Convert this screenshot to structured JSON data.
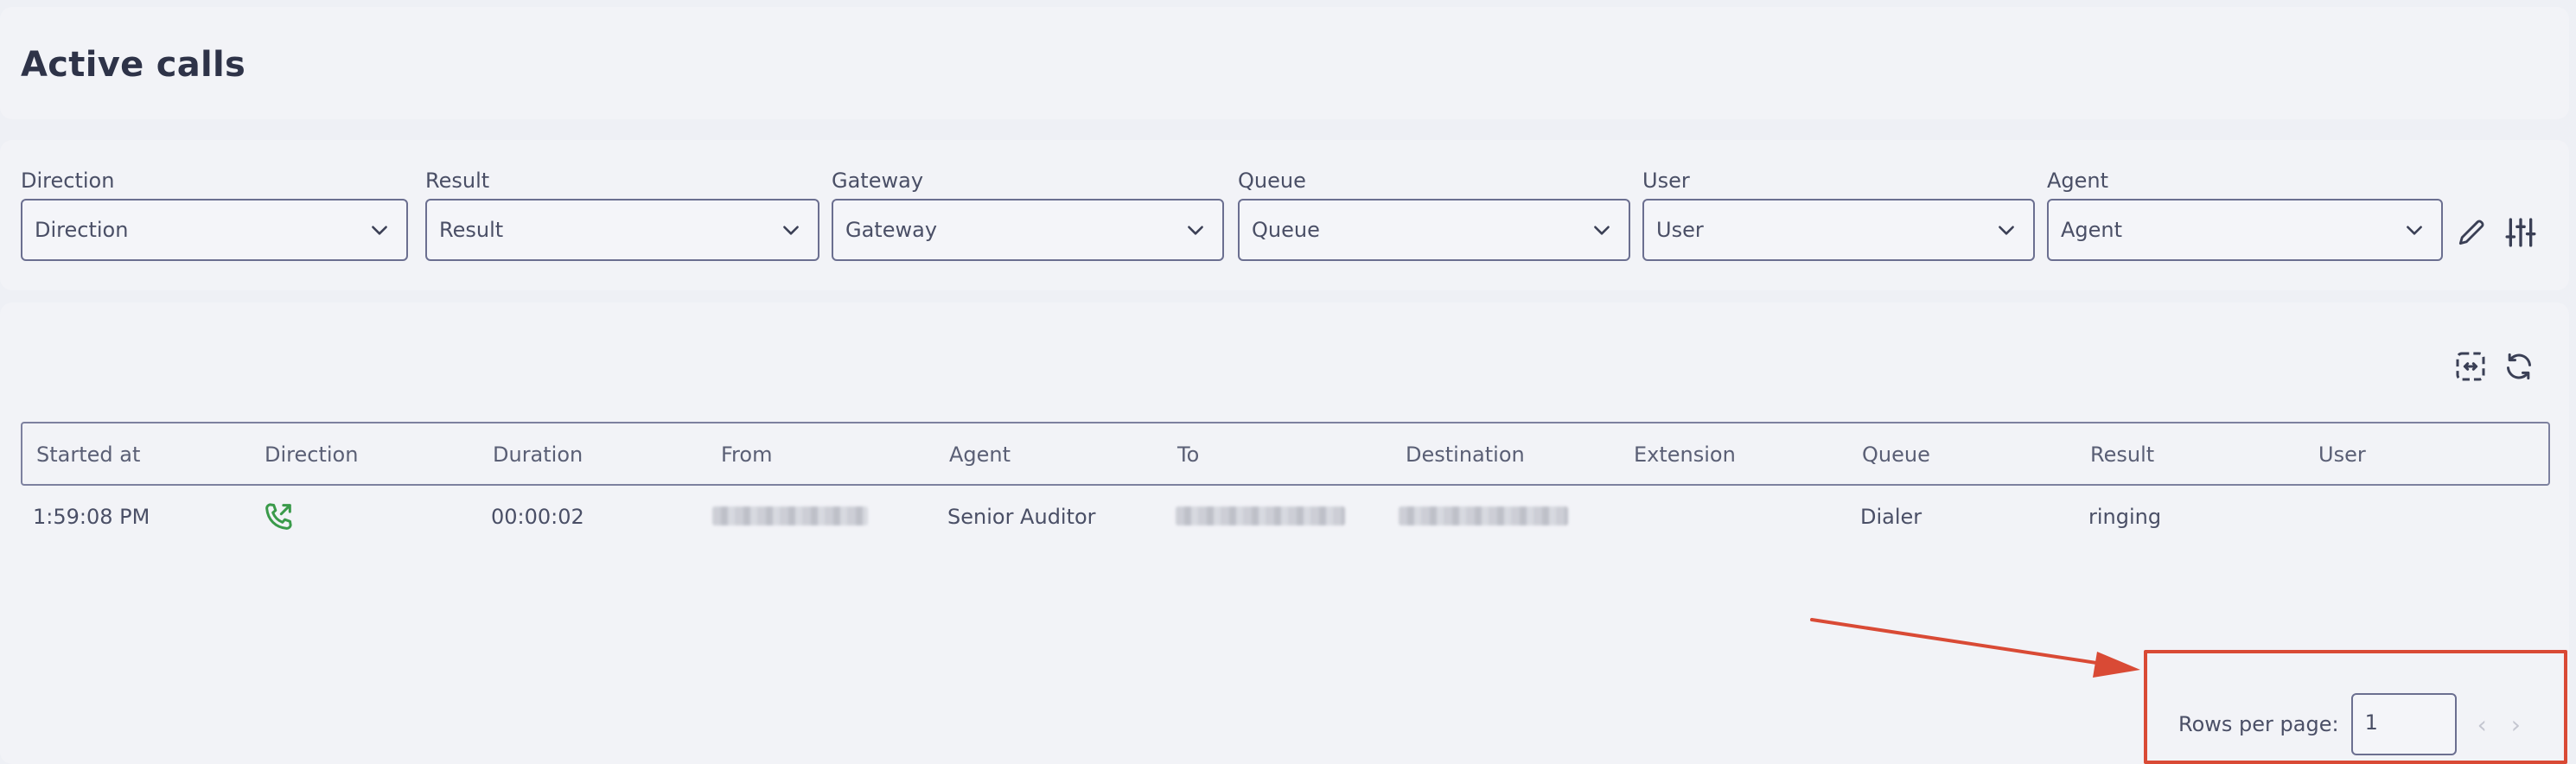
{
  "header": {
    "title": "Active calls"
  },
  "filters": [
    {
      "label": "Direction",
      "value": "Direction"
    },
    {
      "label": "Result",
      "value": "Result"
    },
    {
      "label": "Gateway",
      "value": "Gateway"
    },
    {
      "label": "Queue",
      "value": "Queue"
    },
    {
      "label": "User",
      "value": "User"
    },
    {
      "label": "Agent",
      "value": "Agent"
    }
  ],
  "icons": {
    "chevron": "chevron-down-icon",
    "edit": "pencil-icon",
    "settings": "sliders-icon",
    "expand": "expand-columns-icon",
    "refresh": "refresh-icon",
    "call": "outgoing-call-icon"
  },
  "table": {
    "columns": [
      "Started at",
      "Direction",
      "Duration",
      "From",
      "Agent",
      "To",
      "Destination",
      "Extension",
      "Queue",
      "Result",
      "User"
    ],
    "rows": [
      {
        "started_at": "1:59:08 PM",
        "direction_icon": "outgoing-call-icon",
        "duration": "00:00:02",
        "agent": "Senior Auditor",
        "extension": "",
        "queue": "Dialer",
        "result": "ringing",
        "user": ""
      }
    ]
  },
  "pagination": {
    "rows_per_page_label": "Rows per page:",
    "rows_per_page_value": "1"
  },
  "colors": {
    "accent_border": "#6b6f90",
    "call_icon": "#3a9a4a",
    "annotation": "#d94a35"
  }
}
